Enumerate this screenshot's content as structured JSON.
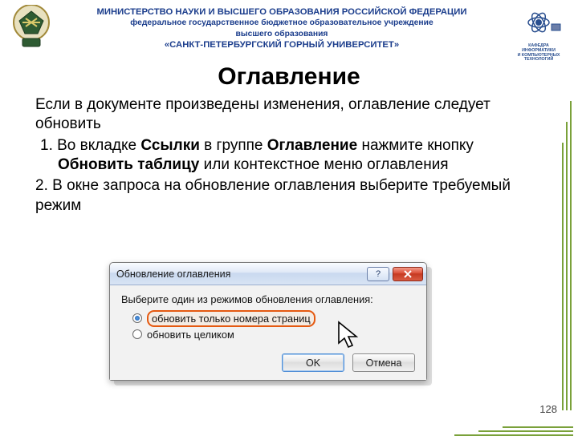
{
  "header": {
    "line1": "МИНИСТЕРСТВО НАУКИ И ВЫСШЕГО ОБРАЗОВАНИЯ РОССИЙСКОЙ ФЕДЕРАЦИИ",
    "line2": "федеральное государственное бюджетное образовательное учреждение",
    "line3": "высшего образования",
    "line4": "«САНКТ-ПЕТЕРБУРГСКИЙ ГОРНЫЙ УНИВЕРСИТЕТ»"
  },
  "title": "Оглавление",
  "body": {
    "lead": "Если в документе произведены изменения, оглавление следует обновить",
    "item1_pre": "Во вкладке ",
    "item1_b1": "Ссылки",
    "item1_mid1": " в группе ",
    "item1_b2": "Оглавление",
    "item1_mid2": " нажмите кнопку ",
    "item1_b3": "Обновить таблицу",
    "item1_post": " или контекстное меню оглавления",
    "item2": "2. В окне запроса на обновление оглавления выберите требуемый режим"
  },
  "dialog": {
    "title": "Обновление оглавления",
    "prompt": "Выберите один из режимов обновления оглавления:",
    "opt1": "обновить только номера страниц",
    "opt2": "обновить целиком",
    "ok": "OK",
    "cancel": "Отмена"
  },
  "pageNumber": "128",
  "rightLogoCaption": {
    "t": "КАФЕДРА",
    "m": "ИНФОРМАТИКИ",
    "b1": "И КОМПЬЮТЕРНЫХ",
    "b2": "ТЕХНОЛОГИЙ"
  }
}
